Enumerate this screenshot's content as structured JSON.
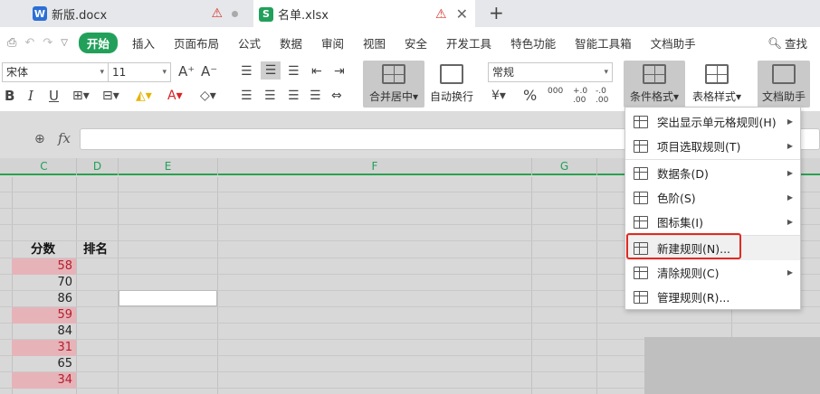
{
  "tabs": [
    {
      "title": "新版.docx",
      "icon": "W"
    },
    {
      "title": "名单.xlsx",
      "icon": "S"
    }
  ],
  "menu": {
    "items": [
      "开始",
      "插入",
      "页面布局",
      "公式",
      "数据",
      "审阅",
      "视图",
      "安全",
      "开发工具",
      "特色功能",
      "智能工具箱",
      "文档助手"
    ],
    "search": "查找"
  },
  "ribbon": {
    "font_name": "宋体",
    "font_size": "11",
    "number_format": "常规",
    "merge_label": "合并居中",
    "wrap_label": "自动换行",
    "cond_format_label": "条件格式",
    "table_style_label": "表格样式",
    "doc_helper_label": "文档助手",
    "grow_font": "A⁺",
    "shrink_font": "A⁻",
    "bold": "B",
    "italic": "I",
    "underline": "U",
    "percent": "%",
    "thousands": "000",
    "inc_decimal": "+.0 .00",
    "dec_decimal": "-.0 .00"
  },
  "formula": {
    "fx": "fx",
    "value": ""
  },
  "grid": {
    "columns": [
      "C",
      "D",
      "E",
      "F",
      "G"
    ],
    "headers": {
      "score": "分数",
      "rank": "排名"
    },
    "scores": [
      {
        "value": "58",
        "fail": true
      },
      {
        "value": "70",
        "fail": false
      },
      {
        "value": "86",
        "fail": false
      },
      {
        "value": "59",
        "fail": true
      },
      {
        "value": "84",
        "fail": false
      },
      {
        "value": "31",
        "fail": true
      },
      {
        "value": "65",
        "fail": false
      },
      {
        "value": "34",
        "fail": true
      }
    ]
  },
  "cf_menu": {
    "items": [
      {
        "label": "突出显示单元格规则(H)",
        "submenu": true
      },
      {
        "label": "项目选取规则(T)",
        "submenu": true
      },
      {
        "label": "数据条(D)",
        "submenu": true
      },
      {
        "label": "色阶(S)",
        "submenu": true
      },
      {
        "label": "图标集(I)",
        "submenu": true
      },
      {
        "label": "新建规则(N)...",
        "submenu": false
      },
      {
        "label": "清除规则(C)",
        "submenu": true
      },
      {
        "label": "管理规则(R)...",
        "submenu": false
      }
    ]
  },
  "colors": {
    "accent": "#22a05a",
    "fail_bg": "#e6b3b9",
    "fail_text": "#b3202d",
    "highlight": "#e02a22"
  }
}
